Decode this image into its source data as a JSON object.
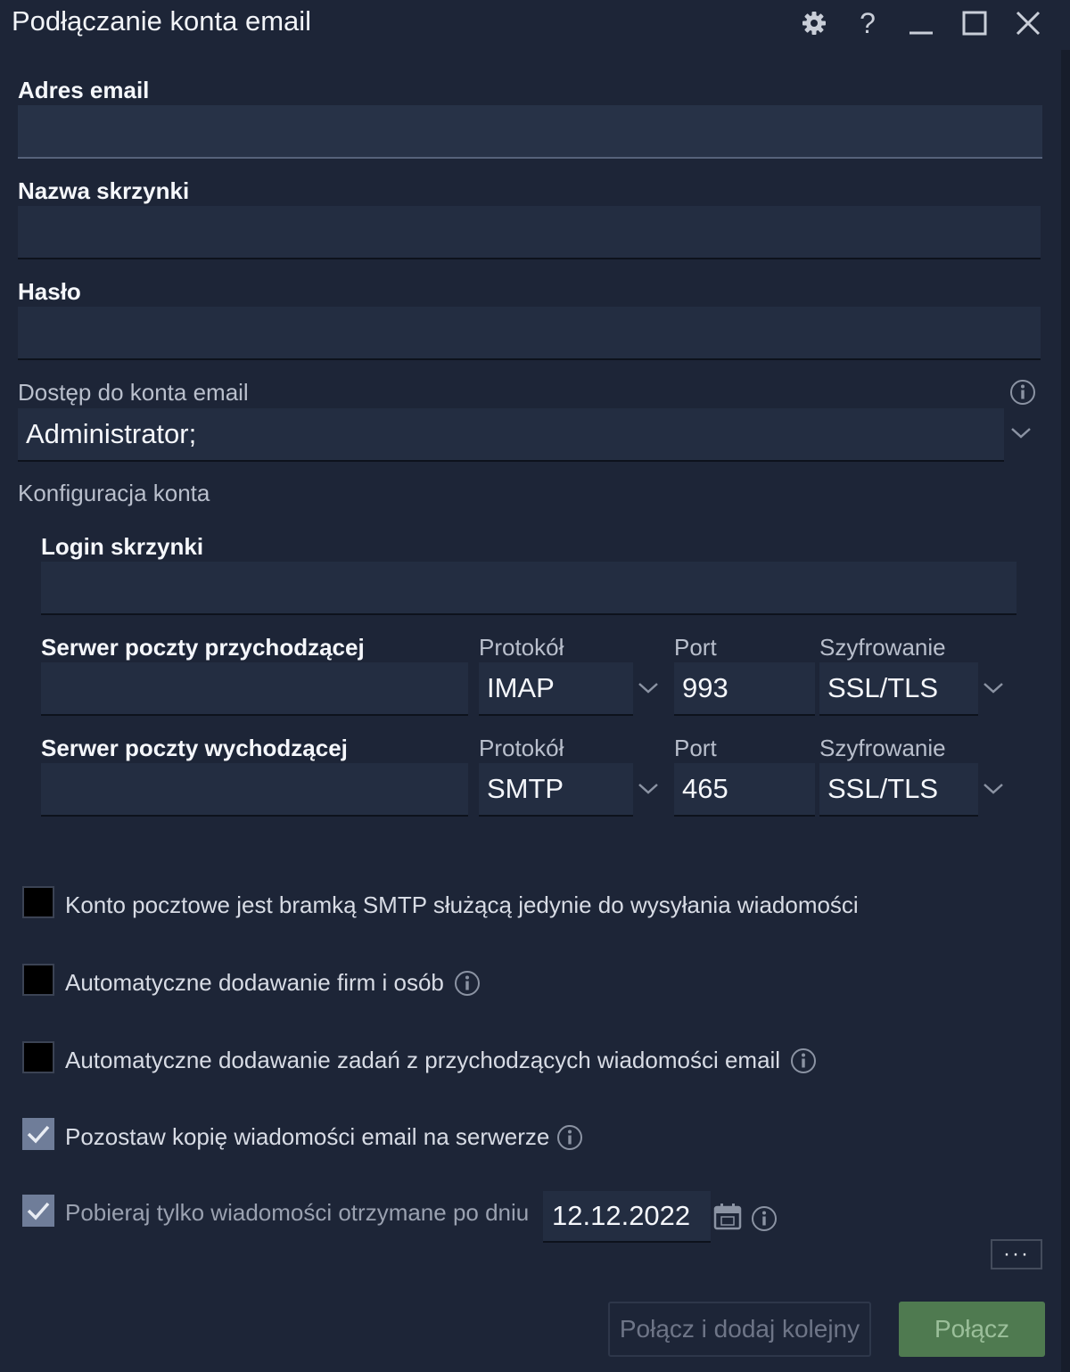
{
  "window": {
    "title": "Podłączanie konta email"
  },
  "fields": {
    "email_label": "Adres email",
    "email_value": "",
    "mailbox_name_label": "Nazwa skrzynki",
    "mailbox_name_value": "",
    "password_label": "Hasło",
    "password_value": "",
    "access_label": "Dostęp do konta email",
    "access_value": "Administrator;",
    "config_label": "Konfiguracja konta",
    "login_label": "Login skrzynki",
    "login_value": ""
  },
  "incoming": {
    "label": "Serwer poczty przychodzącej",
    "server_value": "",
    "protocol_label": "Protokół",
    "protocol_value": "IMAP",
    "port_label": "Port",
    "port_value": "993",
    "encryption_label": "Szyfrowanie",
    "encryption_value": "SSL/TLS"
  },
  "outgoing": {
    "label": "Serwer poczty wychodzącej",
    "server_value": "",
    "protocol_label": "Protokół",
    "protocol_value": "SMTP",
    "port_label": "Port",
    "port_value": "465",
    "encryption_label": "Szyfrowanie",
    "encryption_value": "SSL/TLS"
  },
  "options": [
    {
      "label": "Konto pocztowe jest bramką SMTP służącą jedynie do wysyłania wiadomości",
      "checked": false
    },
    {
      "label": "Automatyczne dodawanie firm i osób",
      "checked": false
    },
    {
      "label": "Automatyczne dodawanie zadań z przychodzących wiadomości email",
      "checked": false
    },
    {
      "label": "Pozostaw kopię wiadomości email na serwerze",
      "checked": true
    },
    {
      "label": "Pobieraj tylko wiadomości otrzymane po dniu",
      "checked": true
    }
  ],
  "date_filter": {
    "value": "12.12.2022"
  },
  "buttons": {
    "more_label": "···",
    "connect_add_label": "Połącz i dodaj kolejny",
    "connect_label": "Połącz"
  },
  "icons": {
    "settings": "gear-icon",
    "help": "help-icon",
    "minimize": "minimize-icon",
    "maximize": "maximize-icon",
    "close": "close-icon",
    "info": "info-icon",
    "calendar": "calendar-icon",
    "chevron": "chevron-down-icon",
    "check": "check-icon"
  },
  "colors": {
    "background": "#1d2537",
    "field": "#232d41",
    "primary_button": "#4f7a50",
    "checked_box": "#6f7d99"
  }
}
